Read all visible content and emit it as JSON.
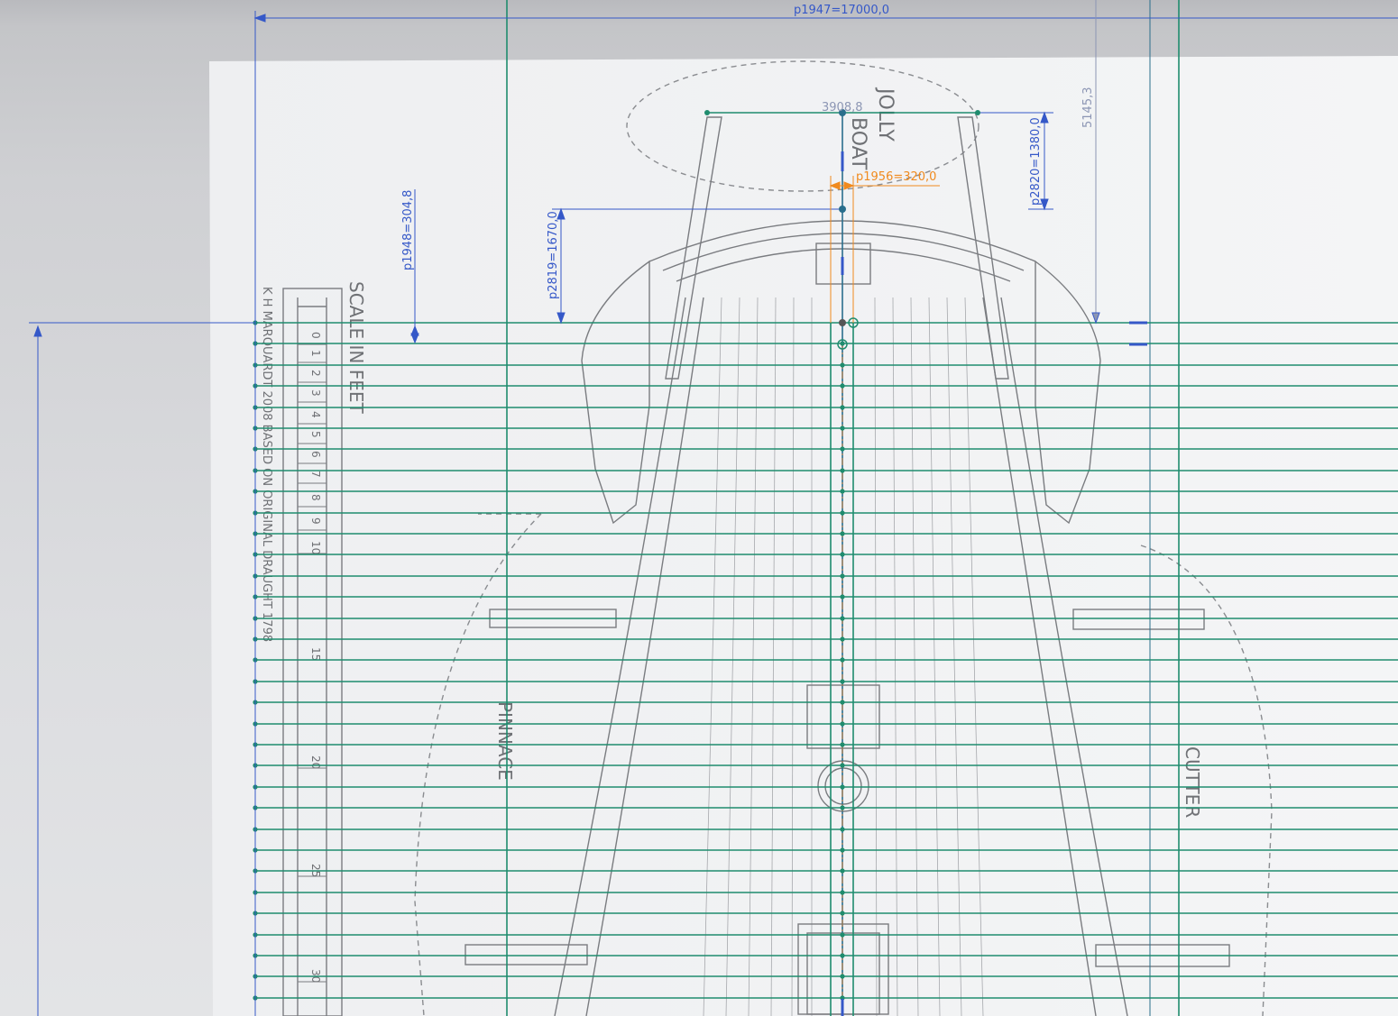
{
  "dimensions": {
    "overall_width": "p1947=17000,0",
    "top_offset_left": "p1948=304,8",
    "stern_depth": "p2819=1670,0",
    "jolly_height": "p2820=1380,0",
    "centre_offset": "p1956=320,0",
    "jolly_span": "3908,8",
    "right_depth": "5145,3"
  },
  "drawing_labels": {
    "jolly_a": "JOLLY",
    "jolly_b": "BOAT",
    "scale_title": "SCALE IN FEET",
    "credit": "K H MARQUARDT 2008  BASED ON ORIGINAL DRAUGHT 1798",
    "pinnace": "PINNACE",
    "cutter": "CUTTER",
    "scale_ticks": [
      "0",
      "1",
      "2",
      "3",
      "4",
      "5",
      "6",
      "7",
      "8",
      "9",
      "10",
      "15",
      "20",
      "25",
      "30"
    ]
  },
  "colors": {
    "construction": "#1f8c6e",
    "dimension": "#3558c8",
    "driving_dim": "#f08a1e",
    "reference_dim": "#8c96b4",
    "blueprint_ink": "#7a7c80",
    "sheet": "#f2f3f4"
  }
}
